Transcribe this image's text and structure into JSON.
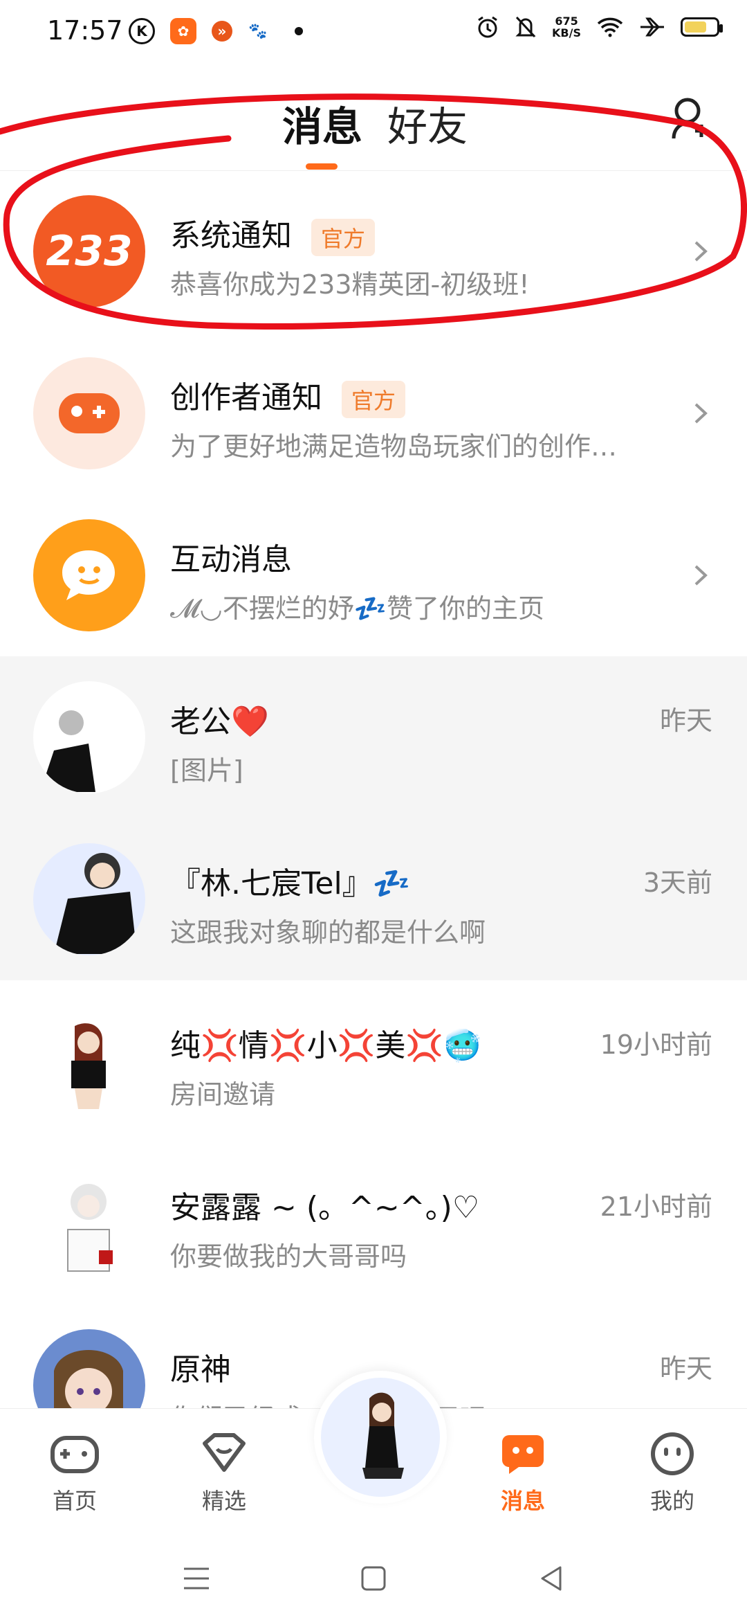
{
  "status_bar": {
    "time": "17:57",
    "left_icons": [
      "k-circle-icon",
      "kuaishou-app-icon",
      "notification-app-icon",
      "baidu-icon"
    ],
    "net_speed_value": "675",
    "net_speed_unit": "KB/S",
    "right_icons": [
      "alarm-icon",
      "mute-icon",
      "wifi-icon",
      "airplane-icon",
      "battery-icon"
    ]
  },
  "header": {
    "tabs": [
      {
        "label": "消息",
        "active": true
      },
      {
        "label": "好友",
        "active": false
      }
    ]
  },
  "messages": [
    {
      "title": "系统通知",
      "badge": "官方",
      "subtitle": "恭喜你成为233精英团-初级班!",
      "avatar_text": "233",
      "avatar_color": "#f25a24"
    },
    {
      "title": "创作者通知",
      "badge": "官方",
      "subtitle": "为了更好地满足造物岛玩家们的创作…",
      "avatar_color": "#fde9df"
    },
    {
      "title": "互动消息",
      "subtitle": "𝓜◡不摆烂的妤💤赞了你的主页",
      "avatar_color": "#ff9f1a"
    },
    {
      "title": "老公❤️",
      "subtitle": "[图片]",
      "time": "昨天"
    },
    {
      "title": "『林.七宸Tel』💤",
      "subtitle": "这跟我对象聊的都是什么啊",
      "time": "3天前"
    },
    {
      "title": "纯💢情💢小💢美💢🥶",
      "subtitle": "房间邀请",
      "time": "19小时前"
    },
    {
      "title": "安露露 ~ (。^~^。)♡",
      "subtitle": "你要做我的大哥哥吗",
      "time": "21小时前"
    },
    {
      "title": "原神",
      "subtitle": "你们已经成……开始聊天吧",
      "time": "昨天"
    }
  ],
  "bottom_nav": [
    {
      "label": "首页",
      "icon": "gamepad-icon",
      "active": false
    },
    {
      "label": "精选",
      "icon": "heart-icon",
      "active": false
    },
    {
      "label": "消息",
      "icon": "message-icon",
      "active": true
    },
    {
      "label": "我的",
      "icon": "face-icon",
      "active": false
    }
  ],
  "colors": {
    "accent": "#ff6a1a",
    "badge_bg": "#fdeadc",
    "badge_text": "#ef7a2a",
    "annotation_red": "#e8101a"
  }
}
